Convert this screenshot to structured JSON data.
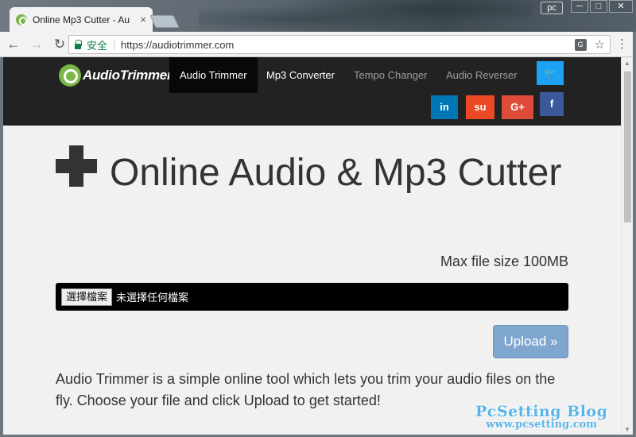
{
  "browser": {
    "tab_title": "Online Mp3 Cutter - Au",
    "tab_close": "×",
    "profile": "pc",
    "window_buttons": {
      "minimize": "─",
      "maximize": "□",
      "close": "✕"
    },
    "nav": {
      "back": "←",
      "forward": "→",
      "reload": "↻"
    },
    "secure_label": "安全",
    "url": "https://audiotrimmer.com",
    "translate_icon": "G",
    "star_icon": "☆",
    "menu_icon": "⋮"
  },
  "site": {
    "logo_text": "AudioTrimmer",
    "nav_items": [
      "Audio Trimmer",
      "Mp3 Converter",
      "Tempo Changer",
      "Audio Reverser"
    ],
    "social": {
      "twitter": "🐦",
      "facebook": "f",
      "linkedin": "in",
      "stumbleupon": "su",
      "googleplus": "G+"
    },
    "heading": "Online Audio & Mp3 Cutter",
    "max_file_size": "Max file size 100MB",
    "file_button": "選擇檔案",
    "file_status": "未選擇任何檔案",
    "upload_button": "Upload »",
    "intro": "Audio Trimmer is a simple online tool which lets you trim your audio files on the fly. Choose your file and click Upload to get started!"
  },
  "watermark": {
    "line1": "PcSetting Blog",
    "line2": "www.pcsetting.com"
  },
  "colors": {
    "nav_bg": "#222222",
    "brand_green": "#7ab648",
    "upload_bg": "#7fa6cf",
    "twitter": "#1da1f2",
    "facebook": "#3b5998",
    "linkedin": "#0077b5",
    "stumbleupon": "#eb4924",
    "googleplus": "#dd4b39"
  }
}
